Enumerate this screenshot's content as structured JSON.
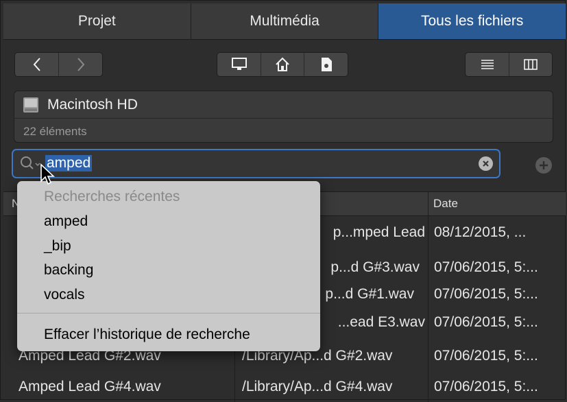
{
  "tabs": [
    {
      "label": "Projet"
    },
    {
      "label": "Multimédia"
    },
    {
      "label": "Tous les fichiers",
      "active": true
    }
  ],
  "toolbar": {
    "back_icon": "chevron-left-icon",
    "forward_icon": "chevron-right-icon",
    "location_icons": [
      "computer-icon",
      "home-icon",
      "document-icon"
    ],
    "view_icons": [
      "list-view-icon",
      "column-view-icon"
    ]
  },
  "location": {
    "icon": "hard-drive-icon",
    "name": "Macintosh HD",
    "count": "22 éléments"
  },
  "search": {
    "value": "amped",
    "icon": "search-icon",
    "clear_icon": "clear-icon",
    "add_icon": "plus-icon"
  },
  "table": {
    "columns": {
      "date": "Date"
    },
    "rows": [
      {
        "name": "",
        "path": "p...mped Lead",
        "date": "08/12/2015, ..."
      },
      {
        "name": "",
        "path": "p...d G#3.wav",
        "date": "07/06/2015, 5:..."
      },
      {
        "name": "",
        "path": "p...d G#1.wav",
        "date": "07/06/2015, 5:..."
      },
      {
        "name": "",
        "path": "...ead E3.wav",
        "date": "07/06/2015, 5:..."
      },
      {
        "name": "Amped Lead G#2.wav",
        "path": "/Library/Ap...d G#2.wav",
        "date": "07/06/2015, 5:..."
      },
      {
        "name": "Amped Lead G#4.wav",
        "path": "/Library/Ap...d G#4.wav",
        "date": "07/06/2015, 5:..."
      }
    ]
  },
  "popup": {
    "header": "Recherches récentes",
    "items": [
      "amped",
      "_bip",
      "backing",
      "vocals"
    ],
    "clear_label": "Effacer l’historique de recherche"
  },
  "colors": {
    "accent": "#2a5a93",
    "background": "#2d2d2d",
    "popup": "#c9c9c9"
  }
}
